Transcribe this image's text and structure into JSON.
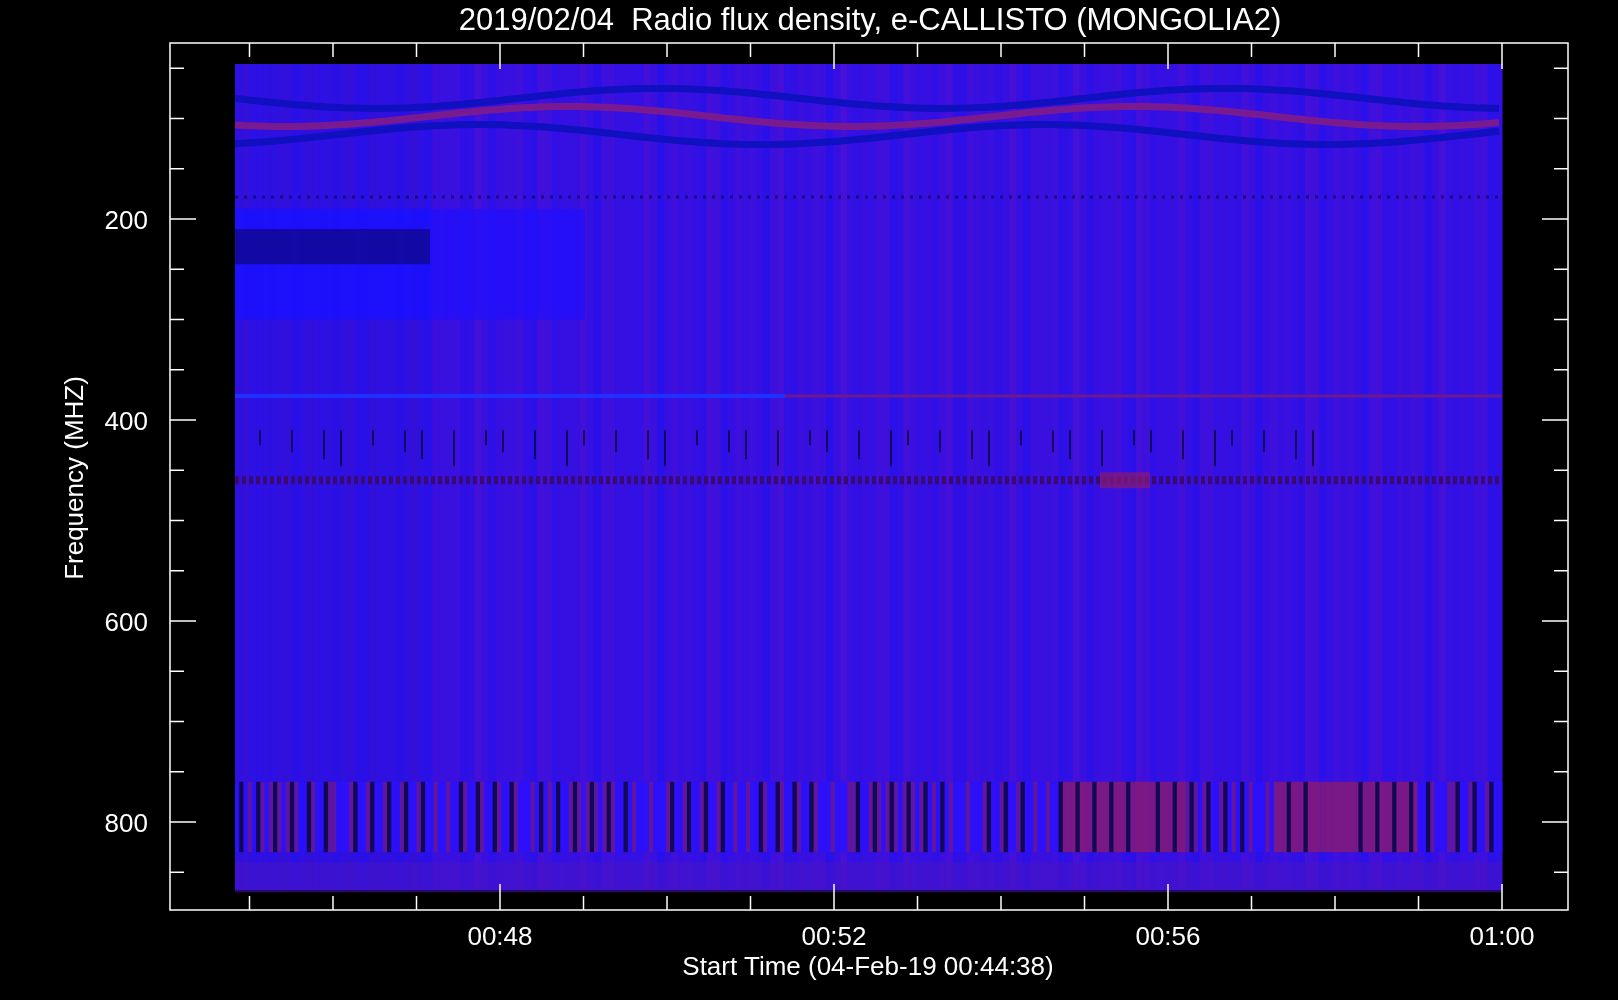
{
  "title": "2019/02/04  Radio flux density, e-CALLISTO (MONGOLIA2)",
  "xlabel": "Start Time (04-Feb-19 00:44:38)",
  "ylabel": "Frequency (MHZ)",
  "xticks": [
    "00:48",
    "00:52",
    "00:56",
    "01:00"
  ],
  "yticks": [
    "200",
    "400",
    "600",
    "800"
  ]
}
